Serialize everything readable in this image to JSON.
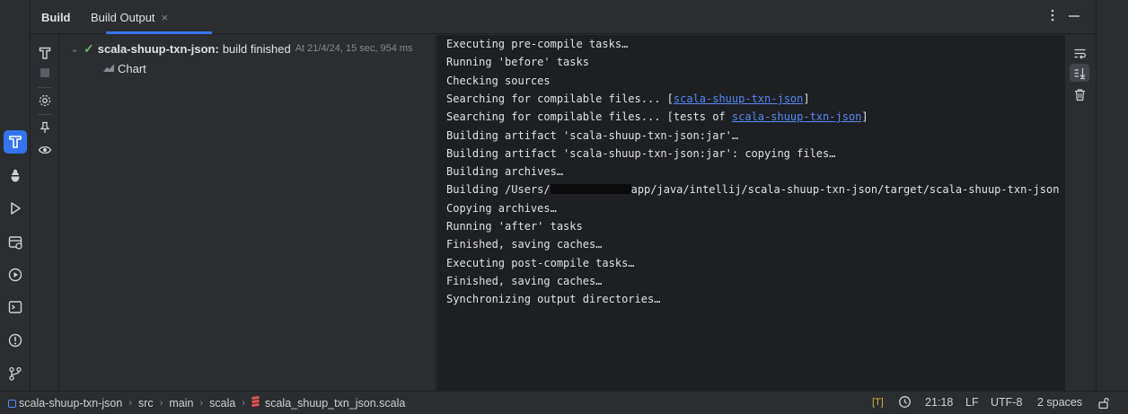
{
  "tabs": {
    "build_label": "Build",
    "build_output_label": "Build Output",
    "close_glyph": "×"
  },
  "header_icons": [
    "more-vertical-icon",
    "minimize-icon"
  ],
  "left_toolbar_icons": [
    "build-hammer-icon",
    "stop-icon",
    "settings-gear-icon",
    "pin-icon",
    "eye-icon"
  ],
  "activity_bar_icons": [
    "build-icon",
    "debug-icon",
    "run-icon",
    "services-icon",
    "run-configurations-icon",
    "terminal-icon",
    "problems-icon",
    "git-icon"
  ],
  "tree": {
    "root_name": "scala-shuup-txn-json:",
    "root_status": "build finished",
    "root_time": "At 21/4/24, 15 sec, 954 ms",
    "child_label": "Chart"
  },
  "console": {
    "lines": [
      {
        "text": "Executing pre-compile tasks…"
      },
      {
        "text": "Running 'before' tasks"
      },
      {
        "text": "Checking sources"
      },
      {
        "before": "Searching for compilable files... [",
        "link": "scala-shuup-txn-json",
        "after": "]"
      },
      {
        "before": "Searching for compilable files... [tests of ",
        "link": "scala-shuup-txn-json",
        "after": "]"
      },
      {
        "text": "Building artifact 'scala-shuup-txn-json:jar'…"
      },
      {
        "text": "Building artifact 'scala-shuup-txn-json:jar': copying files…"
      },
      {
        "text": "Building archives…"
      },
      {
        "redacted_before": "Building /Users/",
        "redacted_after": "app/java/intellij/scala-shuup-txn-json/target/scala-shuup-txn-json"
      },
      {
        "text": "Copying archives…"
      },
      {
        "text": "Running 'after' tasks"
      },
      {
        "text": "Finished, saving caches…"
      },
      {
        "text": "Executing post-compile tasks…"
      },
      {
        "text": "Finished, saving caches…"
      },
      {
        "text": "Synchronizing output directories…"
      }
    ]
  },
  "right_toolbar_icons": [
    "soft-wrap-icon",
    "scroll-to-end-icon",
    "clear-all-icon"
  ],
  "status_bar": {
    "breadcrumbs": [
      "scala-shuup-txn-json",
      "src",
      "main",
      "scala",
      "scala_shuup_txn_json.scala"
    ],
    "breadcrumb_sep": "›",
    "encoding_badge": "[T]",
    "position": "21:18",
    "line_separator": "LF",
    "encoding": "UTF-8",
    "indent": "2 spaces"
  },
  "colors": {
    "accent": "#3574f0",
    "success": "#5fb865",
    "link": "#548af7",
    "badge": "#d3b53b",
    "scala": "#e45550"
  }
}
